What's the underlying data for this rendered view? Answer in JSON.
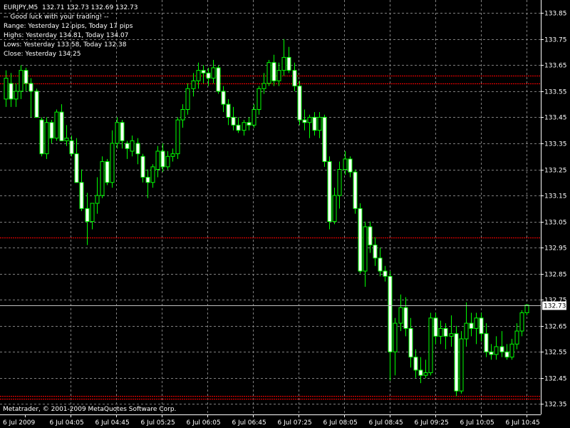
{
  "header": {
    "symbol_line": "EURJPY,M5  132.71 132.73 132.69 132.73",
    "info_lines": [
      "-- Good luck with your trading! --",
      "Range: Yesterday 12 pips, Today 17 pips",
      "Highs: Yesterday 134.81, Today 134.07",
      "Lows: Yesterday 133.58, Today 132.38",
      "Close: Yesterday 134.25"
    ]
  },
  "footer": {
    "copyright": "Metatrader, © 2001-2009 MetaQuotes Software Corp."
  },
  "colors": {
    "background": "#000000",
    "grid": "#7f7f7f",
    "bull": "#00ff00",
    "bear": "#ffffff",
    "bear_outline": "#00ff00",
    "level_line": "#ff0000",
    "current_price_line": "#c0c0c0"
  },
  "chart_data": {
    "type": "candlestick",
    "title": "EURJPY,M5",
    "y_ticks": [
      "133.85",
      "133.75",
      "133.65",
      "133.55",
      "133.45",
      "133.35",
      "133.25",
      "133.15",
      "133.05",
      "132.95",
      "132.85",
      "132.75",
      "132.65",
      "132.55",
      "132.45",
      "132.35"
    ],
    "x_labels": [
      "6 Jul 2009",
      "6 Jul 04:05",
      "6 Jul 04:45",
      "6 Jul 05:25",
      "6 Jul 06:05",
      "6 Jul 06:45",
      "6 Jul 07:25",
      "6 Jul 08:05",
      "6 Jul 08:45",
      "6 Jul 09:25",
      "6 Jul 10:05",
      "6 Jul 10:45"
    ],
    "ylim": [
      132.31,
      133.9
    ],
    "current_price": 132.73,
    "current_price_label": "132.73",
    "level_lines": [
      133.61,
      133.58,
      132.99,
      132.38,
      132.37
    ],
    "grid": true,
    "candles": [
      {
        "o": 133.52,
        "h": 133.63,
        "l": 133.49,
        "c": 133.6
      },
      {
        "o": 133.58,
        "h": 133.62,
        "l": 133.49,
        "c": 133.52
      },
      {
        "o": 133.52,
        "h": 133.58,
        "l": 133.49,
        "c": 133.55
      },
      {
        "o": 133.55,
        "h": 133.65,
        "l": 133.52,
        "c": 133.63
      },
      {
        "o": 133.63,
        "h": 133.64,
        "l": 133.55,
        "c": 133.58
      },
      {
        "o": 133.58,
        "h": 133.6,
        "l": 133.45,
        "c": 133.55
      },
      {
        "o": 133.55,
        "h": 133.56,
        "l": 133.45,
        "c": 133.45
      },
      {
        "o": 133.44,
        "h": 133.45,
        "l": 133.3,
        "c": 133.31
      },
      {
        "o": 133.31,
        "h": 133.45,
        "l": 133.29,
        "c": 133.43
      },
      {
        "o": 133.43,
        "h": 133.44,
        "l": 133.35,
        "c": 133.37
      },
      {
        "o": 133.37,
        "h": 133.48,
        "l": 133.36,
        "c": 133.47
      },
      {
        "o": 133.47,
        "h": 133.5,
        "l": 133.36,
        "c": 133.36
      },
      {
        "o": 133.36,
        "h": 133.42,
        "l": 133.34,
        "c": 133.37
      },
      {
        "o": 133.36,
        "h": 133.38,
        "l": 133.3,
        "c": 133.31
      },
      {
        "o": 133.31,
        "h": 133.37,
        "l": 133.2,
        "c": 133.2
      },
      {
        "o": 133.2,
        "h": 133.25,
        "l": 133.09,
        "c": 133.1
      },
      {
        "o": 133.1,
        "h": 133.16,
        "l": 132.96,
        "c": 133.05
      },
      {
        "o": 133.05,
        "h": 133.12,
        "l": 133.02,
        "c": 133.12
      },
      {
        "o": 133.12,
        "h": 133.22,
        "l": 133.08,
        "c": 133.15
      },
      {
        "o": 133.15,
        "h": 133.3,
        "l": 133.14,
        "c": 133.28
      },
      {
        "o": 133.28,
        "h": 133.29,
        "l": 133.19,
        "c": 133.2
      },
      {
        "o": 133.2,
        "h": 133.4,
        "l": 133.18,
        "c": 133.35
      },
      {
        "o": 133.35,
        "h": 133.45,
        "l": 133.33,
        "c": 133.43
      },
      {
        "o": 133.43,
        "h": 133.44,
        "l": 133.33,
        "c": 133.36
      },
      {
        "o": 133.35,
        "h": 133.36,
        "l": 133.29,
        "c": 133.33
      },
      {
        "o": 133.32,
        "h": 133.38,
        "l": 133.3,
        "c": 133.36
      },
      {
        "o": 133.35,
        "h": 133.37,
        "l": 133.27,
        "c": 133.31
      },
      {
        "o": 133.3,
        "h": 133.31,
        "l": 133.2,
        "c": 133.22
      },
      {
        "o": 133.22,
        "h": 133.25,
        "l": 133.14,
        "c": 133.2
      },
      {
        "o": 133.2,
        "h": 133.27,
        "l": 133.18,
        "c": 133.26
      },
      {
        "o": 133.25,
        "h": 133.34,
        "l": 133.22,
        "c": 133.32
      },
      {
        "o": 133.32,
        "h": 133.35,
        "l": 133.24,
        "c": 133.26
      },
      {
        "o": 133.26,
        "h": 133.32,
        "l": 133.25,
        "c": 133.3
      },
      {
        "o": 133.3,
        "h": 133.33,
        "l": 133.28,
        "c": 133.31
      },
      {
        "o": 133.31,
        "h": 133.45,
        "l": 133.29,
        "c": 133.44
      },
      {
        "o": 133.44,
        "h": 133.5,
        "l": 133.41,
        "c": 133.48
      },
      {
        "o": 133.48,
        "h": 133.58,
        "l": 133.46,
        "c": 133.56
      },
      {
        "o": 133.56,
        "h": 133.62,
        "l": 133.53,
        "c": 133.59
      },
      {
        "o": 133.59,
        "h": 133.66,
        "l": 133.56,
        "c": 133.63
      },
      {
        "o": 133.63,
        "h": 133.65,
        "l": 133.58,
        "c": 133.62
      },
      {
        "o": 133.62,
        "h": 133.64,
        "l": 133.57,
        "c": 133.6
      },
      {
        "o": 133.6,
        "h": 133.67,
        "l": 133.58,
        "c": 133.64
      },
      {
        "o": 133.64,
        "h": 133.65,
        "l": 133.54,
        "c": 133.55
      },
      {
        "o": 133.55,
        "h": 133.57,
        "l": 133.47,
        "c": 133.5
      },
      {
        "o": 133.5,
        "h": 133.52,
        "l": 133.42,
        "c": 133.45
      },
      {
        "o": 133.45,
        "h": 133.49,
        "l": 133.4,
        "c": 133.42
      },
      {
        "o": 133.42,
        "h": 133.45,
        "l": 133.39,
        "c": 133.4
      },
      {
        "o": 133.4,
        "h": 133.44,
        "l": 133.38,
        "c": 133.43
      },
      {
        "o": 133.43,
        "h": 133.45,
        "l": 133.4,
        "c": 133.42
      },
      {
        "o": 133.42,
        "h": 133.5,
        "l": 133.41,
        "c": 133.48
      },
      {
        "o": 133.48,
        "h": 133.57,
        "l": 133.46,
        "c": 133.56
      },
      {
        "o": 133.56,
        "h": 133.62,
        "l": 133.54,
        "c": 133.58
      },
      {
        "o": 133.58,
        "h": 133.67,
        "l": 133.57,
        "c": 133.66
      },
      {
        "o": 133.66,
        "h": 133.69,
        "l": 133.57,
        "c": 133.59
      },
      {
        "o": 133.59,
        "h": 133.66,
        "l": 133.57,
        "c": 133.63
      },
      {
        "o": 133.63,
        "h": 133.75,
        "l": 133.61,
        "c": 133.68
      },
      {
        "o": 133.68,
        "h": 133.72,
        "l": 133.62,
        "c": 133.63
      },
      {
        "o": 133.63,
        "h": 133.66,
        "l": 133.55,
        "c": 133.57
      },
      {
        "o": 133.57,
        "h": 133.59,
        "l": 133.42,
        "c": 133.44
      },
      {
        "o": 133.44,
        "h": 133.48,
        "l": 133.4,
        "c": 133.43
      },
      {
        "o": 133.43,
        "h": 133.46,
        "l": 133.37,
        "c": 133.45
      },
      {
        "o": 133.45,
        "h": 133.47,
        "l": 133.38,
        "c": 133.4
      },
      {
        "o": 133.4,
        "h": 133.47,
        "l": 133.37,
        "c": 133.45
      },
      {
        "o": 133.45,
        "h": 133.46,
        "l": 133.26,
        "c": 133.28
      },
      {
        "o": 133.28,
        "h": 133.3,
        "l": 133.02,
        "c": 133.05
      },
      {
        "o": 133.05,
        "h": 133.18,
        "l": 133.04,
        "c": 133.15
      },
      {
        "o": 133.15,
        "h": 133.28,
        "l": 133.1,
        "c": 133.25
      },
      {
        "o": 133.25,
        "h": 133.32,
        "l": 133.23,
        "c": 133.29
      },
      {
        "o": 133.29,
        "h": 133.3,
        "l": 133.22,
        "c": 133.24
      },
      {
        "o": 133.24,
        "h": 133.25,
        "l": 133.08,
        "c": 133.1
      },
      {
        "o": 133.1,
        "h": 133.12,
        "l": 132.85,
        "c": 132.86
      },
      {
        "o": 132.86,
        "h": 133.05,
        "l": 132.8,
        "c": 133.03
      },
      {
        "o": 133.03,
        "h": 133.05,
        "l": 132.93,
        "c": 132.96
      },
      {
        "o": 132.96,
        "h": 132.99,
        "l": 132.88,
        "c": 132.91
      },
      {
        "o": 132.91,
        "h": 132.95,
        "l": 132.84,
        "c": 132.86
      },
      {
        "o": 132.86,
        "h": 132.88,
        "l": 132.82,
        "c": 132.84
      },
      {
        "o": 132.84,
        "h": 132.86,
        "l": 132.44,
        "c": 132.55
      },
      {
        "o": 132.55,
        "h": 132.68,
        "l": 132.46,
        "c": 132.66
      },
      {
        "o": 132.66,
        "h": 132.77,
        "l": 132.63,
        "c": 132.72
      },
      {
        "o": 132.72,
        "h": 132.76,
        "l": 132.61,
        "c": 132.64
      },
      {
        "o": 132.64,
        "h": 132.68,
        "l": 132.49,
        "c": 132.53
      },
      {
        "o": 132.53,
        "h": 132.56,
        "l": 132.45,
        "c": 132.48
      },
      {
        "o": 132.48,
        "h": 132.53,
        "l": 132.43,
        "c": 132.46
      },
      {
        "o": 132.46,
        "h": 132.52,
        "l": 132.45,
        "c": 132.47
      },
      {
        "o": 132.47,
        "h": 132.7,
        "l": 132.46,
        "c": 132.68
      },
      {
        "o": 132.68,
        "h": 132.7,
        "l": 132.58,
        "c": 132.61
      },
      {
        "o": 132.61,
        "h": 132.67,
        "l": 132.58,
        "c": 132.64
      },
      {
        "o": 132.64,
        "h": 132.66,
        "l": 132.56,
        "c": 132.61
      },
      {
        "o": 132.61,
        "h": 132.69,
        "l": 132.57,
        "c": 132.62
      },
      {
        "o": 132.62,
        "h": 132.65,
        "l": 132.38,
        "c": 132.4
      },
      {
        "o": 132.4,
        "h": 132.63,
        "l": 132.39,
        "c": 132.6
      },
      {
        "o": 132.6,
        "h": 132.74,
        "l": 132.57,
        "c": 132.66
      },
      {
        "o": 132.66,
        "h": 132.7,
        "l": 132.61,
        "c": 132.64
      },
      {
        "o": 132.64,
        "h": 132.7,
        "l": 132.58,
        "c": 132.68
      },
      {
        "o": 132.68,
        "h": 132.7,
        "l": 132.59,
        "c": 132.62
      },
      {
        "o": 132.62,
        "h": 132.66,
        "l": 132.53,
        "c": 132.55
      },
      {
        "o": 132.55,
        "h": 132.58,
        "l": 132.52,
        "c": 132.54
      },
      {
        "o": 132.54,
        "h": 132.61,
        "l": 132.52,
        "c": 132.57
      },
      {
        "o": 132.57,
        "h": 132.63,
        "l": 132.53,
        "c": 132.55
      },
      {
        "o": 132.55,
        "h": 132.58,
        "l": 132.52,
        "c": 132.53
      },
      {
        "o": 132.53,
        "h": 132.6,
        "l": 132.52,
        "c": 132.58
      },
      {
        "o": 132.58,
        "h": 132.66,
        "l": 132.56,
        "c": 132.63
      },
      {
        "o": 132.63,
        "h": 132.71,
        "l": 132.61,
        "c": 132.7
      },
      {
        "o": 132.7,
        "h": 132.73,
        "l": 132.69,
        "c": 132.73
      }
    ]
  }
}
